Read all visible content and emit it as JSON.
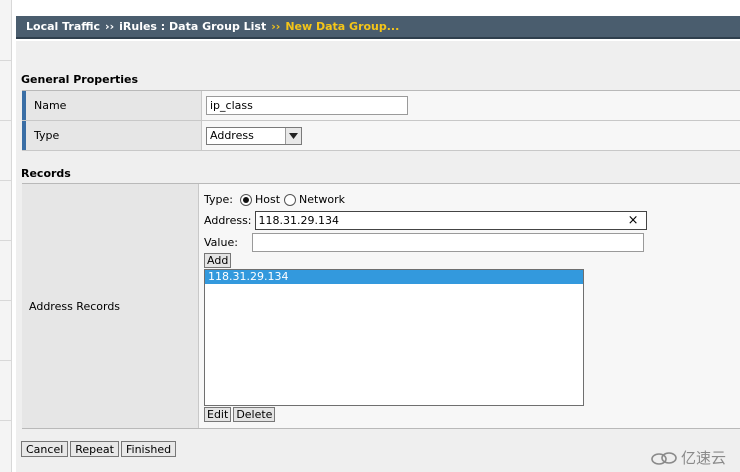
{
  "breadcrumb": {
    "item1": "Local Traffic",
    "sep1": "››",
    "item2": "iRules : Data Group List",
    "sep2": "››",
    "current": "New Data Group..."
  },
  "general": {
    "title": "General Properties",
    "name_label": "Name",
    "name_value": "ip_class",
    "type_label": "Type",
    "type_value": "Address"
  },
  "records": {
    "title": "Records",
    "label": "Address Records",
    "type_label": "Type:",
    "host_label": "Host",
    "network_label": "Network",
    "selected_type": "Host",
    "address_label": "Address:",
    "address_value": "118.31.29.134",
    "value_label": "Value:",
    "value_value": "",
    "add_label": "Add",
    "list_items": [
      "118.31.29.134"
    ],
    "edit_label": "Edit",
    "delete_label": "Delete",
    "clear_symbol": "×"
  },
  "actions": {
    "cancel": "Cancel",
    "repeat": "Repeat",
    "finished": "Finished"
  },
  "watermark": {
    "text": "亿速云"
  },
  "colors": {
    "header_bg": "#4a5d6e",
    "breadcrumb_current": "#f5c518",
    "selection": "#3399dd",
    "label_accent": "#3a6ea5"
  }
}
